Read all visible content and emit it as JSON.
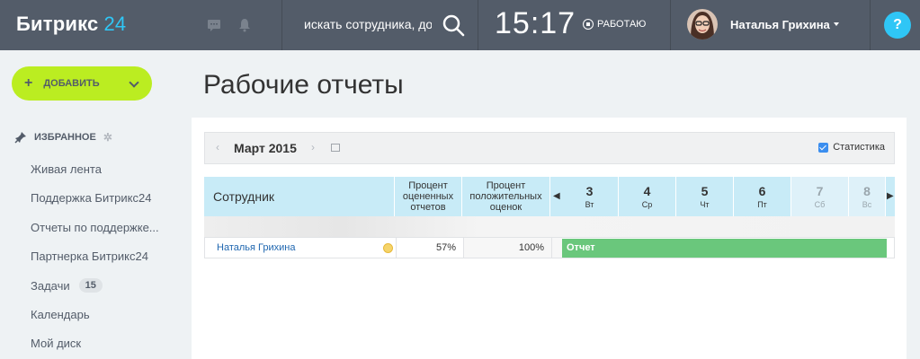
{
  "header": {
    "logo_main": "Битрикс",
    "logo_num": "24",
    "search_text": "искать сотрудника, док",
    "clock": "15:17",
    "work_status": "РАБОТАЮ",
    "user_name": "Наталья Грихина",
    "help": "?"
  },
  "sidebar": {
    "add_label": "ДОБАВИТЬ",
    "favorites_title": "ИЗБРАННОЕ",
    "items": [
      {
        "label": "Живая лента"
      },
      {
        "label": "Поддержка Битрикс24"
      },
      {
        "label": "Отчеты по поддержке..."
      },
      {
        "label": "Партнерка Битрикс24"
      },
      {
        "label": "Задачи",
        "badge": "15"
      },
      {
        "label": "Календарь"
      },
      {
        "label": "Мой диск"
      }
    ]
  },
  "main": {
    "title": "Рабочие отчеты",
    "month": "Март 2015",
    "statistics_label": "Статистика",
    "columns": {
      "employee": "Сотрудник",
      "percent_rated": "Процент оцененных отчетов",
      "percent_positive": "Процент положительных оценок"
    },
    "days": [
      {
        "num": "3",
        "dow": "Вт",
        "weekend": false
      },
      {
        "num": "4",
        "dow": "Ср",
        "weekend": false
      },
      {
        "num": "5",
        "dow": "Чт",
        "weekend": false
      },
      {
        "num": "6",
        "dow": "Пт",
        "weekend": false
      },
      {
        "num": "7",
        "dow": "Сб",
        "weekend": true
      },
      {
        "num": "8",
        "dow": "Вс",
        "weekend": true
      }
    ],
    "rows": [
      {
        "name": "Наталья Грихина",
        "percent_rated": "57%",
        "percent_positive": "100%",
        "report_label": "Отчет"
      }
    ]
  },
  "colors": {
    "header_bg": "#535c69",
    "accent": "#2fc6f6",
    "add_button": "#bbed21",
    "report_bar": "#6ac77c"
  }
}
